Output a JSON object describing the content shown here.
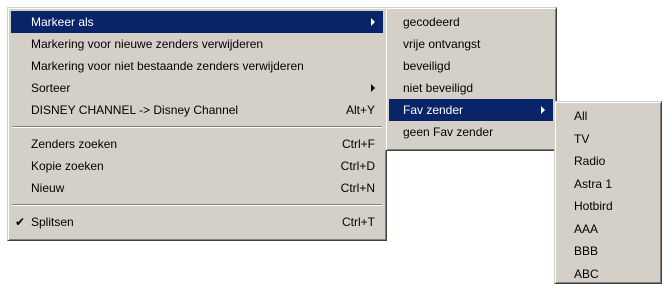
{
  "main_menu": {
    "items": [
      {
        "label": "Markeer als",
        "has_submenu": true
      },
      {
        "label": "Markering voor nieuwe zenders verwijderen"
      },
      {
        "label": "Markering voor niet bestaande zenders verwijderen"
      },
      {
        "label": "Sorteer",
        "has_submenu": true
      },
      {
        "label": "DISNEY CHANNEL -> Disney Channel",
        "shortcut": "Alt+Y"
      },
      {
        "label": "Zenders zoeken",
        "shortcut": "Ctrl+F"
      },
      {
        "label": "Kopie zoeken",
        "shortcut": "Ctrl+D"
      },
      {
        "label": "Nieuw",
        "shortcut": "Ctrl+N"
      },
      {
        "label": "Splitsen",
        "shortcut": "Ctrl+T",
        "checked": true,
        "check_glyph": "✔"
      }
    ]
  },
  "markeer_submenu": {
    "items": [
      {
        "label": "gecodeerd"
      },
      {
        "label": "vrije ontvangst"
      },
      {
        "label": "beveiligd"
      },
      {
        "label": "niet beveiligd"
      },
      {
        "label": "Fav zender",
        "has_submenu": true
      },
      {
        "label": "geen Fav zender"
      }
    ]
  },
  "fav_submenu": {
    "items": [
      {
        "label": "All"
      },
      {
        "label": "TV"
      },
      {
        "label": "Radio"
      },
      {
        "label": "Astra 1"
      },
      {
        "label": "Hotbird"
      },
      {
        "label": "AAA"
      },
      {
        "label": "BBB"
      },
      {
        "label": "ABC"
      }
    ]
  },
  "colors": {
    "menu_face": "#d4d0c8",
    "highlight": "#0a246a",
    "highlight_text": "#ffffff"
  }
}
